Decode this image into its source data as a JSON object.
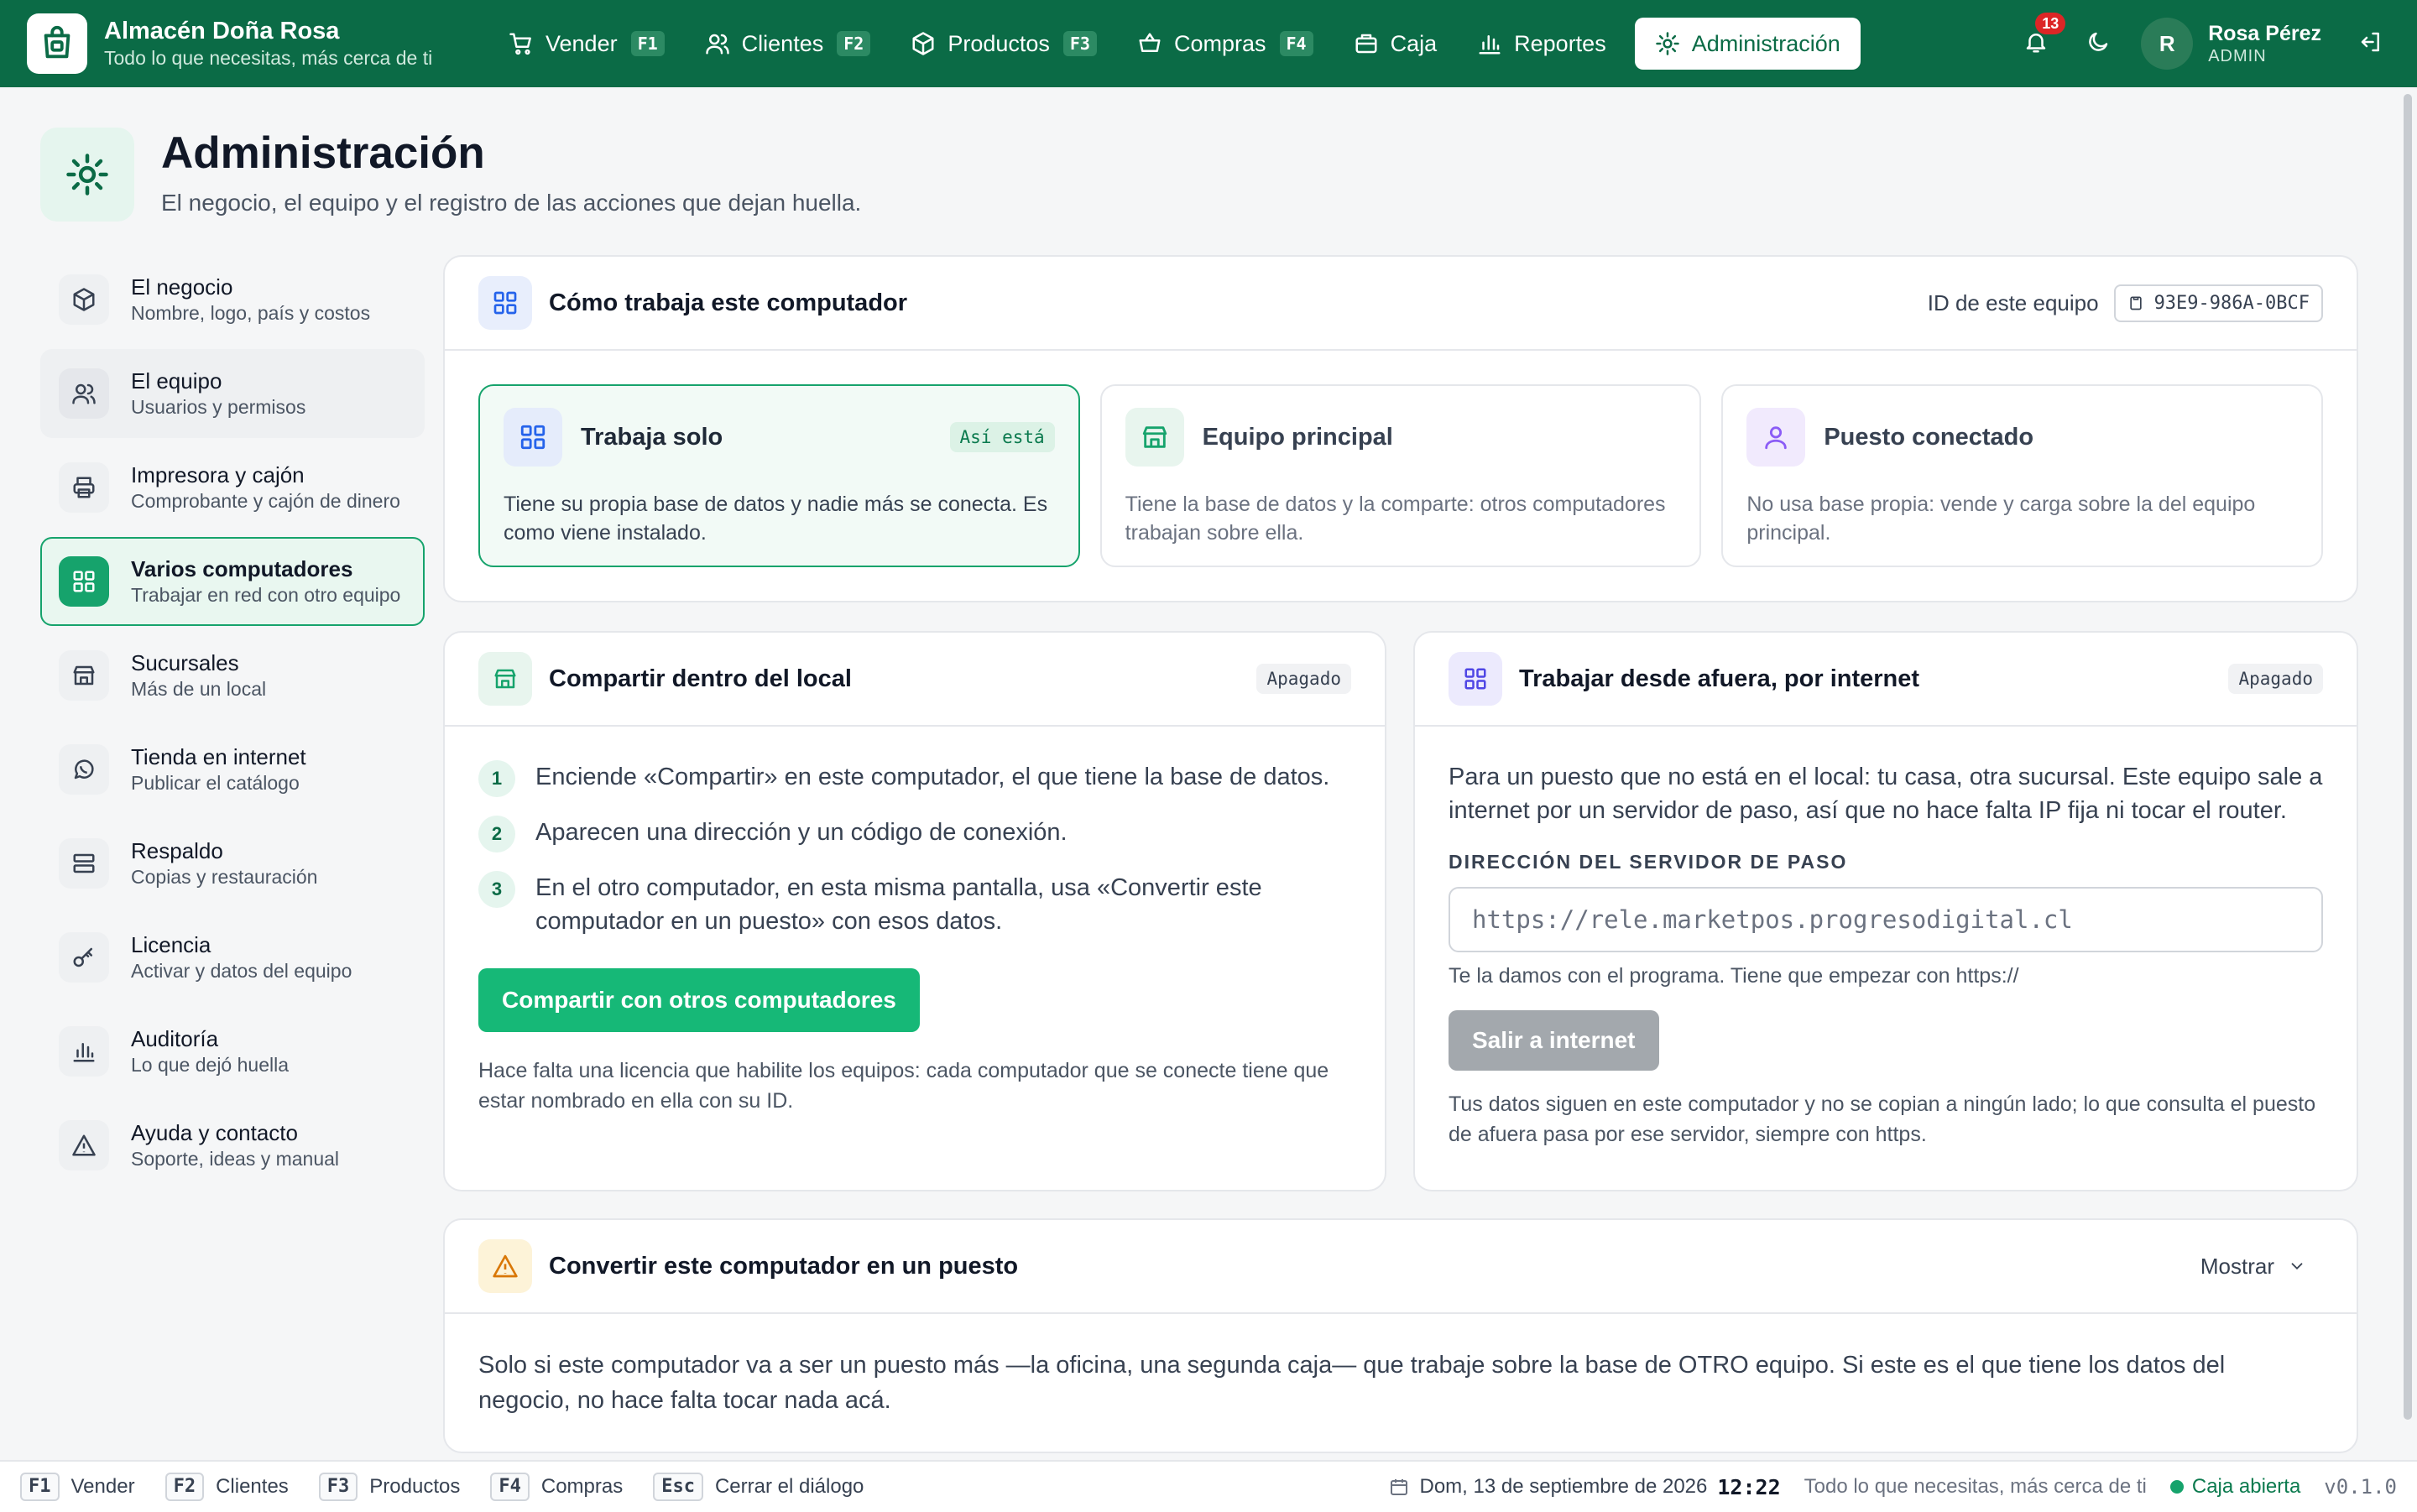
{
  "app": {
    "name": "Almacén Doña Rosa",
    "tagline": "Todo lo que necesitas, más cerca de ti"
  },
  "nav": {
    "items": [
      {
        "label": "Vender",
        "key": "F1",
        "icon": "cart-icon"
      },
      {
        "label": "Clientes",
        "key": "F2",
        "icon": "users-icon"
      },
      {
        "label": "Productos",
        "key": "F3",
        "icon": "box-icon"
      },
      {
        "label": "Compras",
        "key": "F4",
        "icon": "basket-icon"
      },
      {
        "label": "Caja",
        "key": "",
        "icon": "cashbox-icon"
      },
      {
        "label": "Reportes",
        "key": "",
        "icon": "bar-chart-icon"
      },
      {
        "label": "Administración",
        "key": "",
        "icon": "gear-icon"
      }
    ],
    "active": "Administración"
  },
  "notifications": {
    "count": "13"
  },
  "user": {
    "initial": "R",
    "name": "Rosa Pérez",
    "role": "ADMIN"
  },
  "page": {
    "title": "Administración",
    "subtitle": "El negocio, el equipo y el registro de las acciones que dejan huella."
  },
  "sidebar": {
    "items": [
      {
        "label": "El negocio",
        "desc": "Nombre, logo, país y costos"
      },
      {
        "label": "El equipo",
        "desc": "Usuarios y permisos"
      },
      {
        "label": "Impresora y cajón",
        "desc": "Comprobante y cajón de dinero"
      },
      {
        "label": "Varios computadores",
        "desc": "Trabajar en red con otro equipo"
      },
      {
        "label": "Sucursales",
        "desc": "Más de un local"
      },
      {
        "label": "Tienda en internet",
        "desc": "Publicar el catálogo"
      },
      {
        "label": "Respaldo",
        "desc": "Copias y restauración"
      },
      {
        "label": "Licencia",
        "desc": "Activar y datos del equipo"
      },
      {
        "label": "Auditoría",
        "desc": "Lo que dejó huella"
      },
      {
        "label": "Ayuda y contacto",
        "desc": "Soporte, ideas y manual"
      }
    ]
  },
  "how": {
    "title": "Cómo trabaja este computador",
    "id_label": "ID de este equipo",
    "id_value": "93E9-986A-0BCF",
    "modes": [
      {
        "name": "Trabaja solo",
        "badge": "Así está",
        "desc": "Tiene su propia base de datos y nadie más se conecta. Es como viene instalado."
      },
      {
        "name": "Equipo principal",
        "desc": "Tiene la base de datos y la comparte: otros computadores trabajan sobre ella."
      },
      {
        "name": "Puesto conectado",
        "desc": "No usa base propia: vende y carga sobre la del equipo principal."
      }
    ]
  },
  "share": {
    "title": "Compartir dentro del local",
    "status": "Apagado",
    "steps": [
      "Enciende «Compartir» en este computador, el que tiene la base de datos.",
      "Aparecen una dirección y un código de conexión.",
      "En el otro computador, en esta misma pantalla, usa «Convertir este computador en un puesto» con esos datos."
    ],
    "button": "Compartir con otros computadores",
    "note": "Hace falta una licencia que habilite los equipos: cada computador que se conecte tiene que estar nombrado en ella con su ID."
  },
  "internet": {
    "title": "Trabajar desde afuera, por internet",
    "status": "Apagado",
    "intro": "Para un puesto que no está en el local: tu casa, otra sucursal. Este equipo sale a internet por un servidor de paso, así que no hace falta IP fija ni tocar el router.",
    "field_label": "DIRECCIÓN DEL SERVIDOR DE PASO",
    "placeholder": "https://rele.marketpos.progresodigital.cl",
    "hint": "Te la damos con el programa. Tiene que empezar con https://",
    "button": "Salir a internet",
    "foot": "Tus datos siguen en este computador y no se copian a ningún lado; lo que consulta el puesto de afuera pasa por ese servidor, siempre con https."
  },
  "convert": {
    "title": "Convertir este computador en un puesto",
    "toggle": "Mostrar",
    "body": "Solo si este computador va a ser un puesto más —la oficina, una segunda caja— que trabaje sobre la base de OTRO equipo. Si este es el que tiene los datos del negocio, no hace falta tocar nada acá."
  },
  "statusbar": {
    "shortcuts": [
      {
        "key": "F1",
        "label": "Vender"
      },
      {
        "key": "F2",
        "label": "Clientes"
      },
      {
        "key": "F3",
        "label": "Productos"
      },
      {
        "key": "F4",
        "label": "Compras"
      },
      {
        "key": "Esc",
        "label": "Cerrar el diálogo"
      }
    ],
    "date": "Dom, 13 de septiembre de 2026",
    "time": "12:22",
    "tagline": "Todo lo que necesitas, más cerca de ti",
    "register": "Caja abierta",
    "version": "v0.1.0"
  },
  "colors": {
    "brand": "#0b6b46",
    "accent": "#16b877",
    "alert": "#dc2626"
  }
}
